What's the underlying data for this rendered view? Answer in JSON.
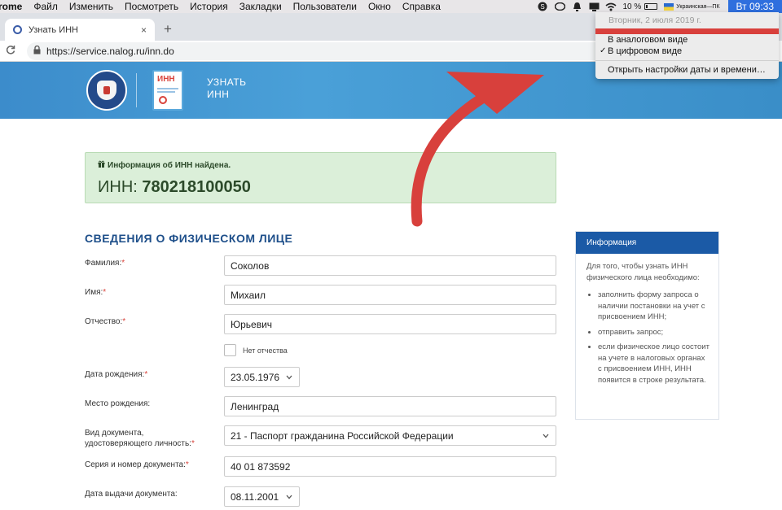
{
  "menubar": {
    "app_name": "rome",
    "items": [
      "Файл",
      "Изменить",
      "Посмотреть",
      "История",
      "Закладки",
      "Пользователи",
      "Окно",
      "Справка"
    ],
    "battery": "10 %",
    "input_source": "Украинская—ПК",
    "clock": "Вт 09:33"
  },
  "date_menu": {
    "date": "Вторник, 2 июля 2019 г.",
    "option_analog": "В аналоговом виде",
    "option_digital": "В цифровом виде",
    "check": "✓",
    "open_settings": "Открыть настройки даты и времени…"
  },
  "browser": {
    "tab_title": "Узнать ИНН",
    "tab_close": "×",
    "new_tab": "+",
    "reload": "C",
    "url": "https://service.nalog.ru/inn.do"
  },
  "header": {
    "doc_label": "ИНН",
    "title": "УЗНАТЬ ИНН"
  },
  "alert": {
    "heading": "Информация об ИНН найдена.",
    "inn_label": "ИНН: ",
    "inn_value": "780218100050"
  },
  "form": {
    "section_title": "СВЕДЕНИЯ О ФИЗИЧЕСКОМ ЛИЦЕ",
    "required_mark": "*",
    "fields": {
      "surname": {
        "label": "Фамилия:",
        "value": "Соколов"
      },
      "name": {
        "label": "Имя:",
        "value": "Михаил"
      },
      "patronymic": {
        "label": "Отчество:",
        "value": "Юрьевич"
      },
      "no_patronymic": {
        "label": "Нет отчества"
      },
      "birth_date": {
        "label": "Дата рождения:",
        "value": "23.05.1976"
      },
      "birth_place": {
        "label": "Место рождения:",
        "value": "Ленинград"
      },
      "doc_type": {
        "label_line1": "Вид документа,",
        "label_line2": "удостоверяющего личность:",
        "value": "21 - Паспорт гражданина Российской Федерации"
      },
      "doc_number": {
        "label": "Серия и номер документа:",
        "value": "40 01 873592"
      },
      "issue_date": {
        "label": "Дата выдачи документа:",
        "value": "08.11.2001"
      }
    }
  },
  "info_panel": {
    "title": "Информация",
    "intro": "Для того, чтобы узнать ИНН физического лица необходимо:",
    "items": [
      "заполнить форму запроса о наличии постановки на учет с присвоением ИНН;",
      "отправить запрос;",
      "если физическое лицо состоит на учете в налоговых органах с присвоением ИНН, ИНН появится в строке результата."
    ]
  },
  "colors": {
    "header_blue": "#3c8ccb",
    "success_bg": "#dbefd9",
    "title_blue": "#1e4f8a",
    "required_red": "#d9433b",
    "annotation_arrow": "#d8403c",
    "clock_highlight": "#2f6fde"
  },
  "icons": {
    "gift": "gift-icon",
    "lock": "lock-icon",
    "chevron": "chevron-down-icon",
    "checkmark": "checkmark-icon"
  }
}
